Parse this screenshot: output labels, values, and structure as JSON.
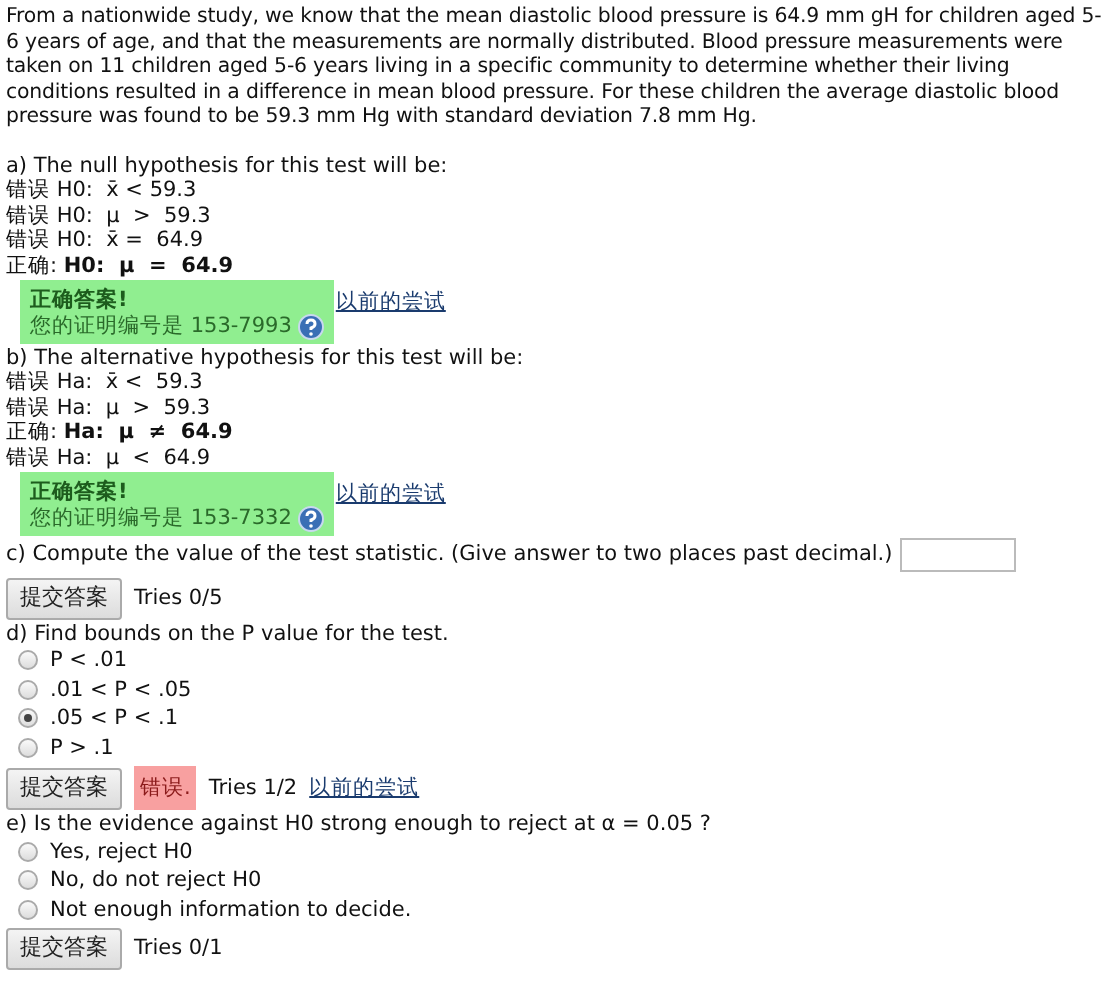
{
  "intro": "From a nationwide study, we know that the mean diastolic blood pressure is 64.9 mm gH for children aged 5-6 years of age, and that the measurements are normally distributed. Blood pressure measurements were taken on 11 children aged 5-6 years living in a specific community to determine whether their living conditions resulted in a difference in mean blood pressure. For these children the average diastolic blood pressure was found to be 59.3 mm Hg with standard deviation 7.8 mm Hg.",
  "parts": [
    {
      "kind": "graded",
      "prompt": "a) The null hypothesis for this test will be:",
      "options": [
        {
          "text": "错误 H0:  x̄ < 59.3"
        },
        {
          "text": "错误 H0:  μ  >  59.3"
        },
        {
          "text": "错误 H0:  x̄ =  64.9"
        },
        {
          "text": "正确: **H0:  μ  =  64.9**"
        }
      ],
      "feedback": {
        "title": "正确答案!",
        "text": "您的证明编号是 153-7993"
      },
      "link": "以前的尝试"
    },
    {
      "kind": "graded",
      "prompt": "b) The alternative hypothesis for this test will be:",
      "options": [
        {
          "text": "错误 Ha:  x̄ <  59.3"
        },
        {
          "text": "错误 Ha:  μ  >  59.3"
        },
        {
          "text": "正确: **Ha:  μ  ≠  64.9**"
        },
        {
          "text": "错误 Ha:  μ  <  64.9"
        }
      ],
      "feedback": {
        "title": "正确答案!",
        "text": "您的证明编号是 153-7332"
      },
      "link": "以前的尝试"
    },
    {
      "kind": "input",
      "prompt": "c) Compute the value of the test statistic. (Give answer to two places past decimal.)",
      "button": "提交答案",
      "tries": "Tries 0/5"
    },
    {
      "kind": "radio",
      "prompt": "d) Find bounds on the P value for the test.",
      "options": [
        {
          "text": "P < .01",
          "selected": false
        },
        {
          "text": ".01 < P < .05",
          "selected": false
        },
        {
          "text": ".05 < P < .1",
          "selected": true
        },
        {
          "text": "P > .1",
          "selected": false
        }
      ],
      "button": "提交答案",
      "error": "错误.",
      "tries": "Tries 1/2",
      "link": "以前的尝试"
    },
    {
      "kind": "radio",
      "prompt": "e) Is the evidence against H0 strong enough to reject at α = 0.05 ?",
      "options": [
        {
          "text": "Yes, reject H0",
          "selected": false
        },
        {
          "text": "No, do not reject H0",
          "selected": false
        },
        {
          "text": "Not enough information to decide.",
          "selected": false
        }
      ],
      "button": "提交答案",
      "tries": "Tries 0/1"
    }
  ]
}
